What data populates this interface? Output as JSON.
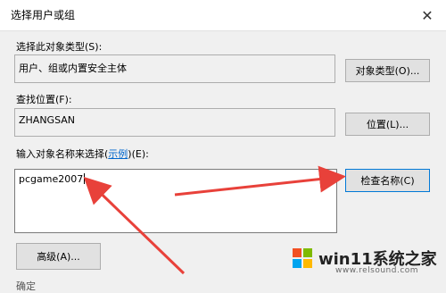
{
  "window": {
    "title": "选择用户或组",
    "close_glyph": "✕"
  },
  "object_type": {
    "label": "选择此对象类型(S):",
    "value": "用户、组或内置安全主体",
    "button": "对象类型(O)..."
  },
  "location": {
    "label": "查找位置(F):",
    "value": "ZHANGSAN",
    "button": "位置(L)..."
  },
  "names": {
    "label_prefix": "输入对象名称来选择(",
    "label_link": "示例",
    "label_suffix": ")(E):",
    "value": "pcgame2007",
    "check_button": "检查名称(C)"
  },
  "advanced_button": "高级(A)...",
  "bottom_partial": "确定",
  "watermark": {
    "brand": "win11系统之家",
    "url": "www.relsound.com"
  },
  "colors": {
    "arrow": "#e8413a",
    "link": "#0066cc",
    "focus_border": "#0078d7"
  }
}
